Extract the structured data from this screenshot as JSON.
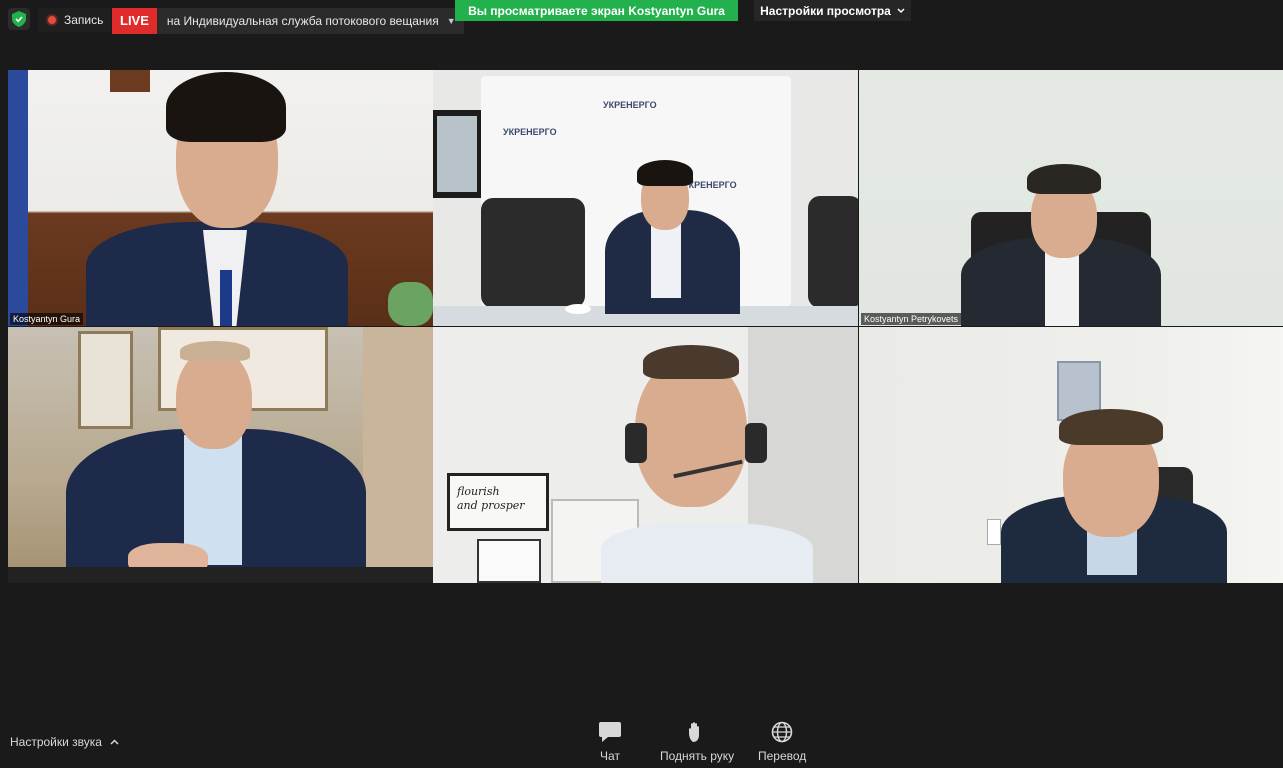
{
  "topbar": {
    "record_label": "Запись",
    "live_badge": "LIVE",
    "live_text": "на Индивидуальная служба потокового вещания",
    "share_banner": "Вы просматриваете экран Kostyantyn Gura",
    "view_options": "Настройки просмотра"
  },
  "tiles": [
    {
      "name": "Kostyantyn Gura"
    },
    {
      "name": ""
    },
    {
      "name": "Kostyantyn Petrykovets"
    },
    {
      "name": ""
    },
    {
      "name": ""
    },
    {
      "name": ""
    }
  ],
  "poster": {
    "line1": "flourish",
    "line2": "and prosper"
  },
  "backdrop_text": "УКРЕНЕРГО",
  "bottombar": {
    "audio_settings": "Настройки звука",
    "chat": "Чат",
    "raise_hand": "Поднять руку",
    "translate": "Перевод"
  },
  "colors": {
    "share_green": "#23b14d",
    "live_red": "#e02b2b",
    "background": "#1a1a1a"
  }
}
